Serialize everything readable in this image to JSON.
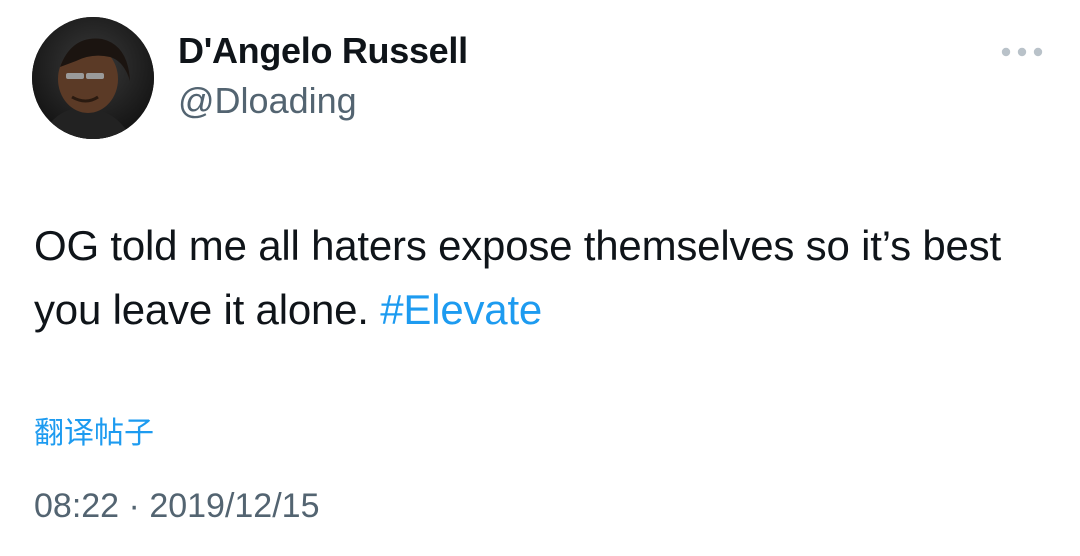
{
  "author": {
    "display_name": "D'Angelo Russell",
    "handle": "@Dloading"
  },
  "more_menu": {
    "icon": "more-horizontal-icon"
  },
  "tweet": {
    "text": "OG told me all haters expose themselves so it’s best you leave it alone. ",
    "hashtag": "#Elevate"
  },
  "translate": {
    "label": "翻译帖子"
  },
  "meta": {
    "time": "08:22",
    "separator": " · ",
    "date": "2019/12/15"
  },
  "colors": {
    "link": "#1d9bf0",
    "secondary_text": "#536471",
    "primary_text": "#0f1419"
  }
}
